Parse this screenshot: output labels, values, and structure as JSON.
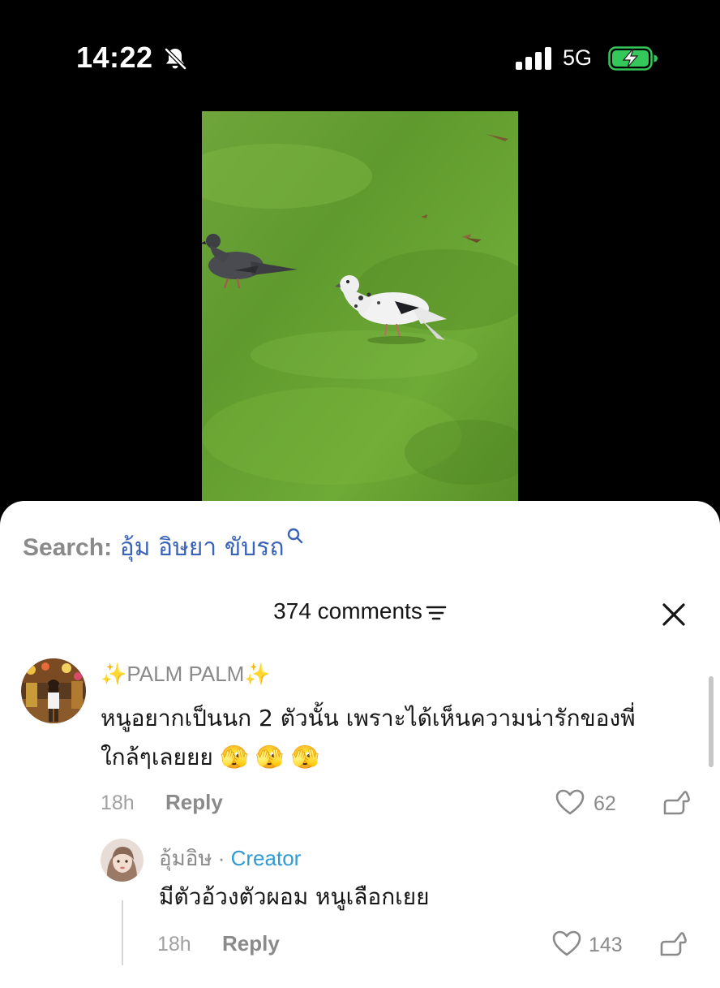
{
  "status_bar": {
    "time": "14:22",
    "bell_icon": "bell-slash-icon",
    "signal_icon": "cellular-signal-icon",
    "network": "5G",
    "battery_icon": "battery-charging-icon",
    "battery_color": "#34c759"
  },
  "video": {
    "content": "video-thumbnail"
  },
  "search": {
    "label": "Search:",
    "query": "อุ้ม อิษยา ขับรถ",
    "icon": "search-icon",
    "query_color": "#3a64b8"
  },
  "comments": {
    "count_label": "374 comments",
    "sort_icon": "sort-icon",
    "close_icon": "close-icon",
    "items": [
      {
        "username": "✨PALM PALM✨",
        "text_line1": "หนูอยากเป็นนก 2 ตัวนั้น เพราะได้เห็นความน่ารักของพี่",
        "text_line2": "ใกล้ๆเลยยย 🫣 🫣 🫣",
        "time": "18h",
        "reply_label": "Reply",
        "likes": "62"
      }
    ],
    "replies": [
      {
        "username": "อุ้มอิษ",
        "separator": " · ",
        "badge": "Creator",
        "text": "มีตัวอ้วงตัวผอม หนูเลือกเยย",
        "time": "18h",
        "reply_label": "Reply",
        "likes": "143"
      }
    ]
  }
}
